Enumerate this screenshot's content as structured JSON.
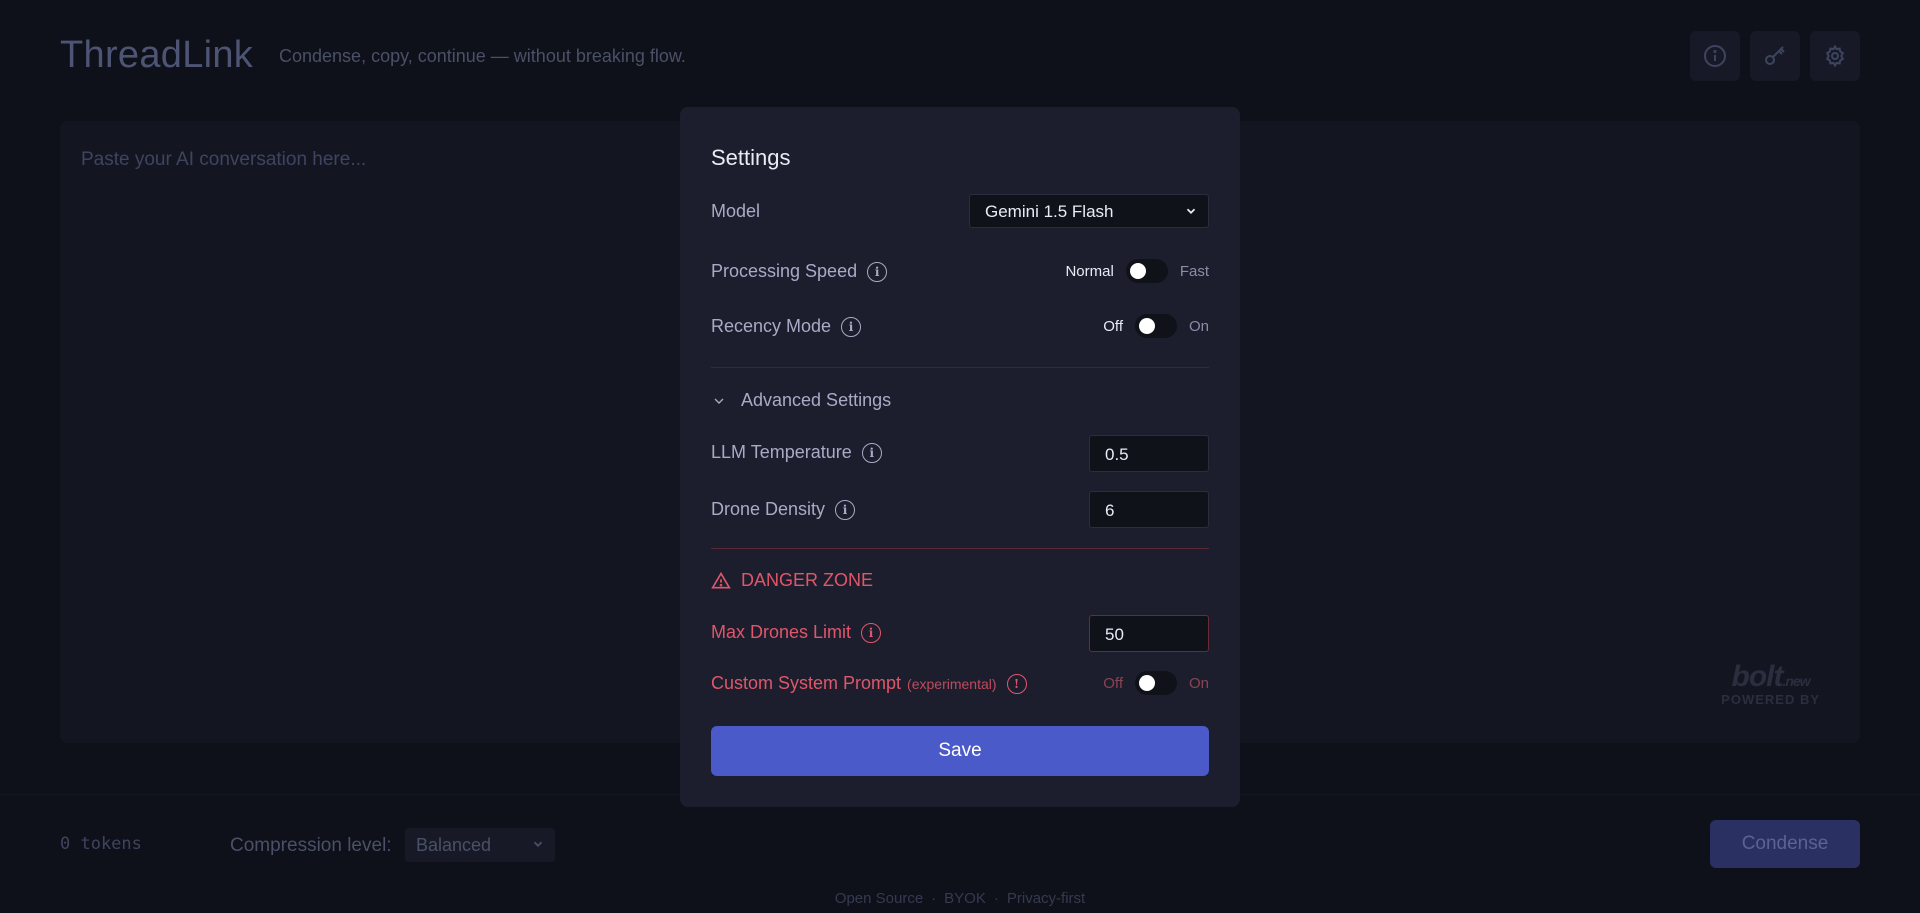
{
  "header": {
    "app_title": "ThreadLink",
    "tagline": "Condense, copy, continue — without breaking flow."
  },
  "main": {
    "paste_placeholder": "Paste your AI conversation here...",
    "bolt_logo": "bolt",
    "bolt_logo_suffix": ".new",
    "bolt_sub": "POWERED BY"
  },
  "footer": {
    "tokens": "0 tokens",
    "compression_label": "Compression level:",
    "compression_value": "Balanced",
    "condense_label": "Condense",
    "links": [
      "Open Source",
      "BYOK",
      "Privacy-first"
    ],
    "separator": "·"
  },
  "settings": {
    "title": "Settings",
    "model": {
      "label": "Model",
      "value": "Gemini 1.5 Flash"
    },
    "processing_speed": {
      "label": "Processing Speed",
      "off_label": "Normal",
      "on_label": "Fast",
      "enabled": false
    },
    "recency_mode": {
      "label": "Recency Mode",
      "off_label": "Off",
      "on_label": "On",
      "enabled": false
    },
    "advanced": {
      "label": "Advanced Settings",
      "temperature": {
        "label": "LLM Temperature",
        "value": "0.5"
      },
      "drone_density": {
        "label": "Drone Density",
        "value": "6"
      }
    },
    "danger_zone": {
      "title": "DANGER ZONE",
      "max_drones": {
        "label": "Max Drones Limit",
        "value": "50"
      },
      "custom_prompt": {
        "label": "Custom System Prompt",
        "note": "(experimental)",
        "off_label": "Off",
        "on_label": "On",
        "enabled": false
      }
    },
    "save_label": "Save"
  },
  "colors": {
    "background": "#0e1119",
    "modal": "#1c1e2d",
    "accent": "#4a5ac8",
    "danger": "#e0566a"
  }
}
